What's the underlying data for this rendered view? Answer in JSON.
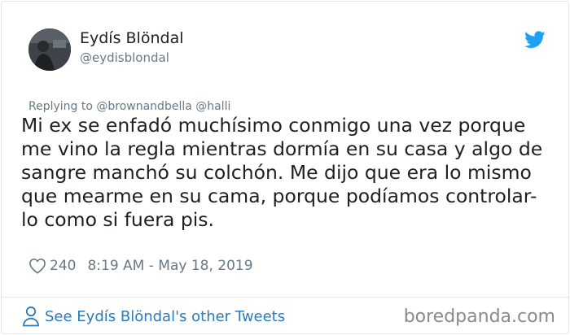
{
  "author": {
    "display_name": "Eydís Blöndal",
    "handle": "@eydisblondal"
  },
  "reply_context": "Replying to @brownandbella @halli",
  "tweet": {
    "lines": [
      "Mi ex se enfadó muchísimo conmigo una vez porque",
      "me vino la regla mientras dormía en su casa y algo de",
      "sangre manchó su colchón. Me dijo que era lo mismo",
      "que mearme en su cama, porque podíamos controlar-",
      "lo como si fuera pis."
    ]
  },
  "meta": {
    "likes": "240",
    "timestamp": "8:19 AM - May 18, 2019"
  },
  "footer": {
    "see_more": "See Eydís Blöndal's other Tweets",
    "watermark": "boredpanda.com"
  },
  "colors": {
    "link": "#2b7bb9",
    "muted": "#697882",
    "twitter_blue": "#1da1f2",
    "divider": "#e1e8ed"
  },
  "icons": [
    "avatar",
    "twitter-bird-icon",
    "heart-icon",
    "person-icon"
  ]
}
